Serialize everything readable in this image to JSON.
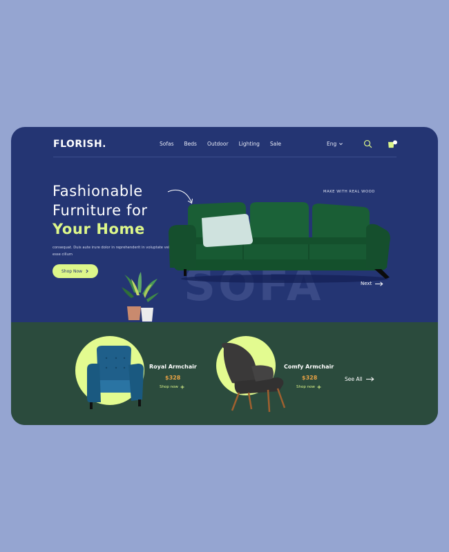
{
  "brand": {
    "logo": "FLORISH."
  },
  "nav": {
    "items": [
      "Sofas",
      "Beds",
      "Outdoor",
      "Lighting",
      "Sale"
    ]
  },
  "lang": {
    "label": "Eng"
  },
  "icons": {
    "search": "search-icon",
    "cart": "shopping-bag-icon",
    "lang_caret": "chevron-down-icon",
    "next": "arrow-right-icon",
    "shop": "chevron-right-icon",
    "add": "plus-icon"
  },
  "hero": {
    "title_line1": "Fashionable",
    "title_line2": "Furniture for",
    "title_accent": "Your Home",
    "description": "consequat. Duis aute irure dolor in reprehenderit in voluptate velit esse cillum",
    "cta": "Shop Now",
    "tagline": "MAKE WITH REAL WOOD",
    "watermark": "SOFA",
    "next": "Next"
  },
  "products": [
    {
      "name": "Royal Armchair",
      "price": "$328",
      "cta": "Shop now"
    },
    {
      "name": "Comfy Armchair",
      "price": "$328",
      "cta": "Shop now"
    }
  ],
  "see_all": "See All",
  "colors": {
    "page_bg": "#95a5d1",
    "hero_bg": "#243573",
    "strip_bg": "#2b4b3d",
    "accent_lime": "#ddf78a",
    "price_orange": "#e8a244"
  }
}
